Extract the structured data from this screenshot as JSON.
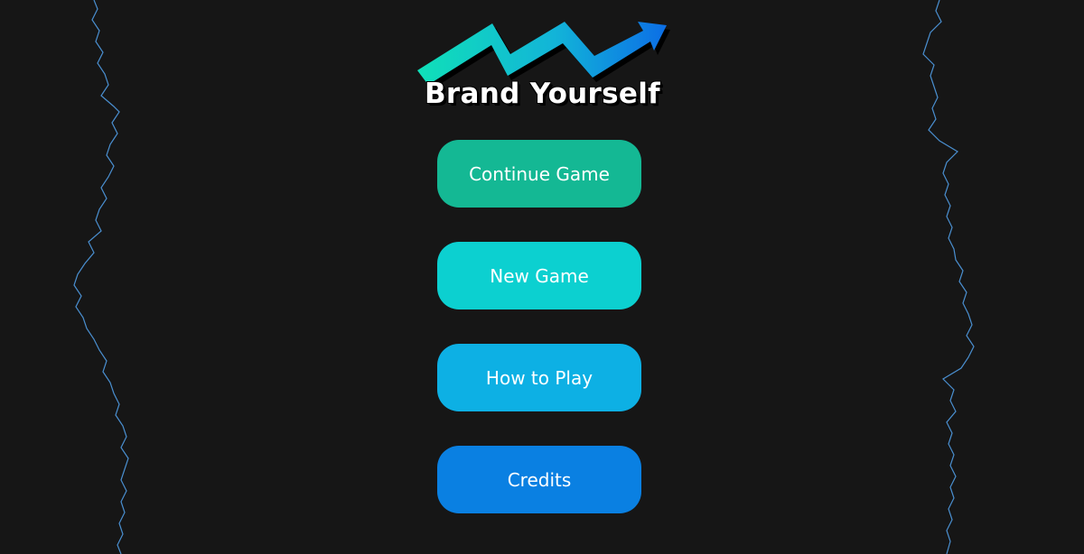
{
  "logo": {
    "title": "Brand Yourself",
    "icon": "trend-arrow-icon"
  },
  "menu": {
    "buttons": [
      {
        "label": "Continue Game",
        "color": "#14b894"
      },
      {
        "label": "New Game",
        "color": "#0cd0d0"
      },
      {
        "label": "How to Play",
        "color": "#0db0e4"
      },
      {
        "label": "Credits",
        "color": "#0a80e2"
      }
    ]
  },
  "theme": {
    "background": "#161616",
    "wave_color": "#4a8fd0"
  }
}
